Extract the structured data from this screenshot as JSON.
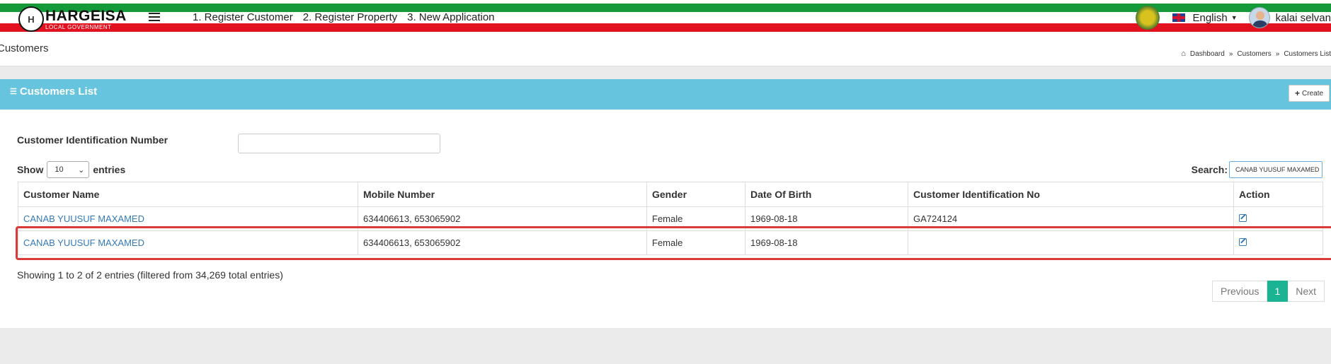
{
  "topbar": {
    "logo_title": "HARGEISA",
    "logo_subtitle": "LOCAL GOVERNMENT",
    "logo_emblem": "H",
    "nav_links": [
      "1. Register Customer",
      "2. Register Property",
      "3. New Application"
    ],
    "language": "English",
    "user_name": "kalai selvan"
  },
  "page": {
    "title": "Customers",
    "breadcrumb": [
      "Dashboard",
      "Customers",
      "Customers List"
    ]
  },
  "panel": {
    "title": "Customers List",
    "create_label": "Create"
  },
  "filter": {
    "label": "Customer Identification Number",
    "value": ""
  },
  "table_controls": {
    "show_label": "Show",
    "entries_label": "entries",
    "page_size": "10",
    "search_label": "Search:",
    "search_value": "CANAB YUUSUF MAXAMED"
  },
  "table": {
    "columns": [
      "Customer Name",
      "Mobile Number",
      "Gender",
      "Date Of Birth",
      "Customer Identification No",
      "Action"
    ],
    "rows": [
      {
        "name": "CANAB YUUSUF MAXAMED",
        "mobile": "634406613, 653065902",
        "gender": "Female",
        "dob": "1969-08-18",
        "cid": "GA724124"
      },
      {
        "name": "CANAB YUUSUF MAXAMED",
        "mobile": "634406613, 653065902",
        "gender": "Female",
        "dob": "1969-08-18",
        "cid": ""
      }
    ]
  },
  "footer": {
    "info": "Showing 1 to 2 of 2 entries (filtered from 34,269 total entries)",
    "previous": "Previous",
    "current_page": "1",
    "next": "Next"
  },
  "colors": {
    "flag_green": "#159a3a",
    "flag_red": "#e2111f",
    "panel_header": "#67c4de",
    "link": "#337ab7",
    "active_page": "#1ab394",
    "highlight_box": "#d93a3a"
  },
  "icons": {
    "menu": "hamburger-icon",
    "home": "home-icon",
    "list": "list-icon",
    "create": "plus-icon",
    "edit": "edit-icon",
    "language_flag": "uk-flag-icon"
  }
}
